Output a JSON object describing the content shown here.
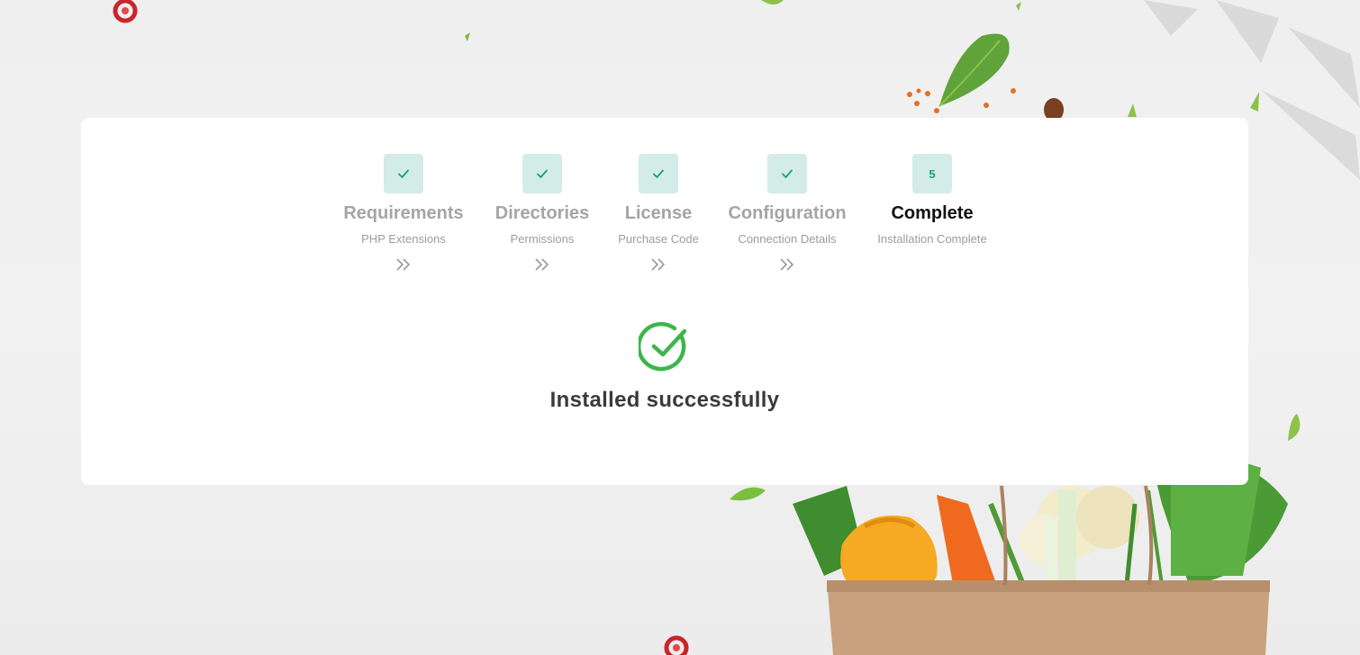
{
  "steps": [
    {
      "status": "done",
      "title": "Requirements",
      "subtitle": "PHP Extensions"
    },
    {
      "status": "done",
      "title": "Directories",
      "subtitle": "Permissions"
    },
    {
      "status": "done",
      "title": "License",
      "subtitle": "Purchase Code"
    },
    {
      "status": "done",
      "title": "Configuration",
      "subtitle": "Connection Details"
    },
    {
      "status": "active",
      "number": "5",
      "title": "Complete",
      "subtitle": "Installation Complete"
    }
  ],
  "result": {
    "message": "Installed successfully",
    "icon": "check-circle-icon",
    "color": "#3cb64a"
  },
  "colors": {
    "step_box_bg": "#d3ece7",
    "step_check": "#1d9d80",
    "step_title_inactive": "#a5a5a5",
    "step_title_active": "#111111"
  }
}
